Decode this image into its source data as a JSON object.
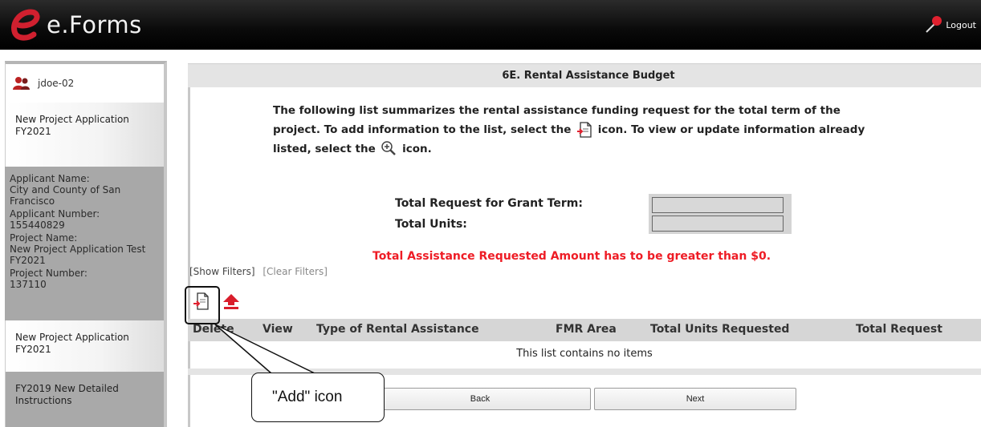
{
  "header": {
    "app_name": "e.Forms",
    "logout_label": "Logout"
  },
  "sidebar": {
    "user": "jdoe-02",
    "nav_top": "New Project Application FY2021",
    "applicant": {
      "name_label": "Applicant Name:",
      "name_value": "City and County of San Francisco",
      "number_label": "Applicant Number:",
      "number_value": "155440829",
      "project_label": "Project Name:",
      "project_value": "New Project Application Test FY2021",
      "project_number_label": "Project Number:",
      "project_number_value": "137110"
    },
    "nav_middle": "New Project Application FY2021",
    "nav_bottom": "FY2019 New Detailed Instructions"
  },
  "main": {
    "title": "6E. Rental Assistance Budget",
    "intro_part1": "The following list summarizes the rental assistance funding request for the total term of the project. To add information to the list, select the",
    "intro_part2": "icon. To view or update information already listed, select the",
    "intro_part3": "icon.",
    "total_request_label": "Total Request for Grant Term:",
    "total_units_label": "Total Units:",
    "total_request_value": "",
    "total_units_value": "",
    "error_message": "Total Assistance Requested Amount has to be greater than $0.",
    "show_filters": "[Show Filters]",
    "clear_filters": "[Clear Filters]",
    "table_columns": [
      "Delete",
      "View",
      "Type of Rental Assistance",
      "FMR Area",
      "Total Units Requested",
      "Total Request"
    ],
    "empty_message": "This list contains no items",
    "back_label": "Back",
    "next_label": "Next"
  },
  "annotation": {
    "callout_text": "\"Add\" icon"
  },
  "icons": {
    "add": "add-document-icon",
    "view": "magnify-icon",
    "upload": "upload-icon",
    "user": "user-icon",
    "logout": "logout-icon"
  }
}
